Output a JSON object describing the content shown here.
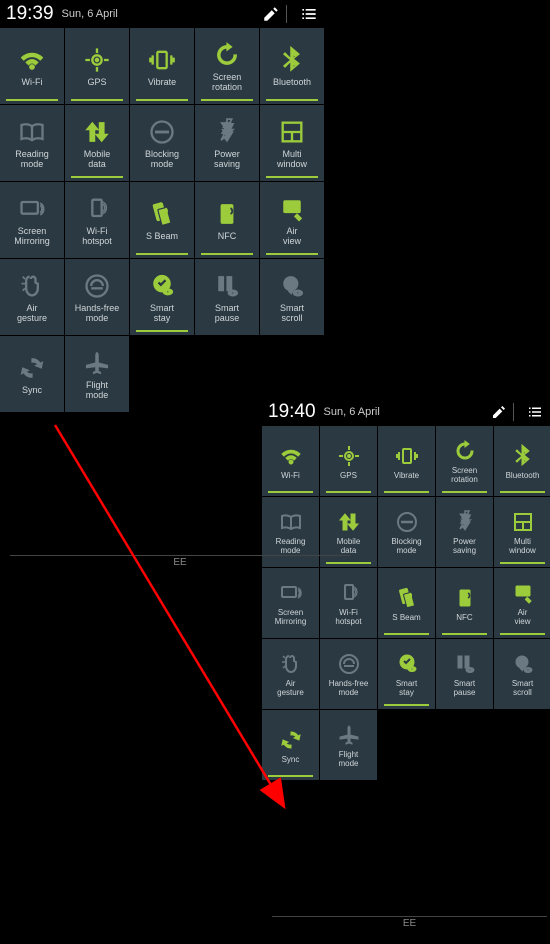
{
  "panel1": {
    "time": "19:39",
    "date": "Sun, 6 April",
    "ee_label": "EE",
    "tiles": [
      {
        "label": "Wi-Fi",
        "icon": "wifi",
        "on": true
      },
      {
        "label": "GPS",
        "icon": "gps",
        "on": true
      },
      {
        "label": "Vibrate",
        "icon": "vibrate",
        "on": true
      },
      {
        "label": "Screen\nrotation",
        "icon": "rotation",
        "on": true
      },
      {
        "label": "Bluetooth",
        "icon": "bluetooth",
        "on": true
      },
      {
        "label": "Reading\nmode",
        "icon": "reading",
        "on": false
      },
      {
        "label": "Mobile\ndata",
        "icon": "mobiledata",
        "on": true
      },
      {
        "label": "Blocking\nmode",
        "icon": "blocking",
        "on": false
      },
      {
        "label": "Power\nsaving",
        "icon": "powersaving",
        "on": false
      },
      {
        "label": "Multi\nwindow",
        "icon": "multiwindow",
        "on": true
      },
      {
        "label": "Screen\nMirroring",
        "icon": "mirroring",
        "on": false
      },
      {
        "label": "Wi-Fi\nhotspot",
        "icon": "hotspot",
        "on": false
      },
      {
        "label": "S Beam",
        "icon": "sbeam",
        "on": true
      },
      {
        "label": "NFC",
        "icon": "nfc",
        "on": true
      },
      {
        "label": "Air\nview",
        "icon": "airview",
        "on": true
      },
      {
        "label": "Air\ngesture",
        "icon": "airgesture",
        "on": false
      },
      {
        "label": "Hands-free\nmode",
        "icon": "handsfree",
        "on": false
      },
      {
        "label": "Smart\nstay",
        "icon": "smartstay",
        "on": true
      },
      {
        "label": "Smart\npause",
        "icon": "smartpause",
        "on": false
      },
      {
        "label": "Smart\nscroll",
        "icon": "smartscroll",
        "on": false
      },
      {
        "label": "Sync",
        "icon": "sync",
        "on": false
      },
      {
        "label": "Flight\nmode",
        "icon": "flight",
        "on": false
      }
    ]
  },
  "panel2": {
    "time": "19:40",
    "date": "Sun, 6 April",
    "ee_label": "EE",
    "tiles": [
      {
        "label": "Wi-Fi",
        "icon": "wifi",
        "on": true
      },
      {
        "label": "GPS",
        "icon": "gps",
        "on": true
      },
      {
        "label": "Vibrate",
        "icon": "vibrate",
        "on": true
      },
      {
        "label": "Screen\nrotation",
        "icon": "rotation",
        "on": true
      },
      {
        "label": "Bluetooth",
        "icon": "bluetooth",
        "on": true
      },
      {
        "label": "Reading\nmode",
        "icon": "reading",
        "on": false
      },
      {
        "label": "Mobile\ndata",
        "icon": "mobiledata",
        "on": true
      },
      {
        "label": "Blocking\nmode",
        "icon": "blocking",
        "on": false
      },
      {
        "label": "Power\nsaving",
        "icon": "powersaving",
        "on": false
      },
      {
        "label": "Multi\nwindow",
        "icon": "multiwindow",
        "on": true
      },
      {
        "label": "Screen\nMirroring",
        "icon": "mirroring",
        "on": false
      },
      {
        "label": "Wi-Fi\nhotspot",
        "icon": "hotspot",
        "on": false
      },
      {
        "label": "S Beam",
        "icon": "sbeam",
        "on": true
      },
      {
        "label": "NFC",
        "icon": "nfc",
        "on": true
      },
      {
        "label": "Air\nview",
        "icon": "airview",
        "on": true
      },
      {
        "label": "Air\ngesture",
        "icon": "airgesture",
        "on": false
      },
      {
        "label": "Hands-free\nmode",
        "icon": "handsfree",
        "on": false
      },
      {
        "label": "Smart\nstay",
        "icon": "smartstay",
        "on": true
      },
      {
        "label": "Smart\npause",
        "icon": "smartpause",
        "on": false
      },
      {
        "label": "Smart\nscroll",
        "icon": "smartscroll",
        "on": false
      },
      {
        "label": "Sync",
        "icon": "sync",
        "on": true
      },
      {
        "label": "Flight\nmode",
        "icon": "flight",
        "on": false
      }
    ]
  },
  "colors": {
    "accent": "#9ccc3c",
    "tile_bg": "#2a3942",
    "off_icon": "#6b7a82",
    "arrow": "#ff0000"
  }
}
